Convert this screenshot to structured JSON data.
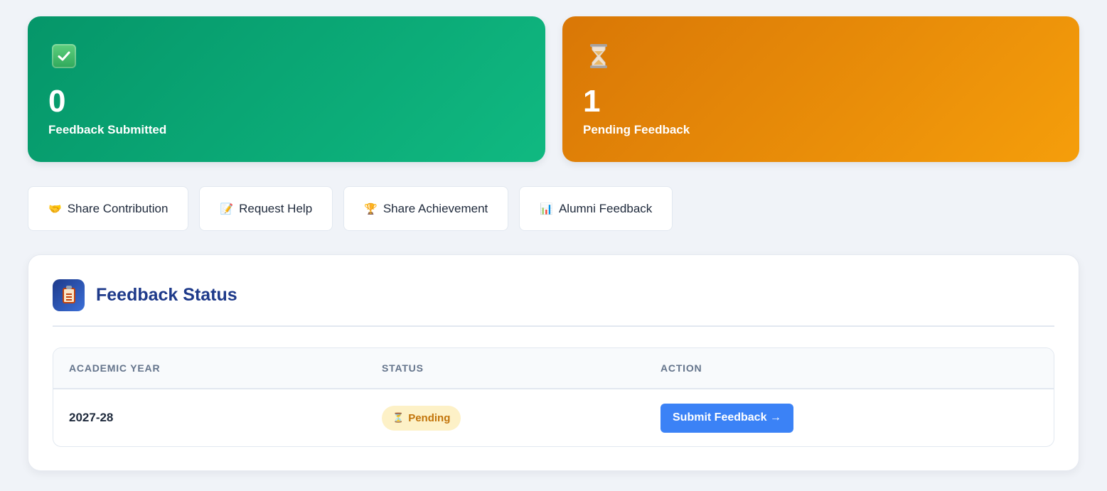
{
  "stats": [
    {
      "value": "0",
      "label": "Feedback Submitted",
      "icon": "check-mark-icon",
      "color": "#059669"
    },
    {
      "value": "1",
      "label": "Pending Feedback",
      "icon": "hourglass-icon",
      "emoji": "⏳",
      "color": "#d97706"
    }
  ],
  "actions": [
    {
      "emoji": "🤝",
      "label": "Share Contribution",
      "icon": "handshake-icon"
    },
    {
      "emoji": "📝",
      "label": "Request Help",
      "icon": "memo-icon"
    },
    {
      "emoji": "🏆",
      "label": "Share Achievement",
      "icon": "trophy-icon"
    },
    {
      "emoji": "📊",
      "label": "Alumni Feedback",
      "icon": "bar-chart-icon"
    }
  ],
  "panel": {
    "title": "Feedback Status",
    "icon": "clipboard-icon",
    "table": {
      "headers": [
        "ACADEMIC YEAR",
        "STATUS",
        "ACTION"
      ],
      "rows": [
        {
          "year": "2027-28",
          "status_emoji": "⏳",
          "status": "Pending",
          "action": "Submit Feedback →"
        }
      ]
    }
  },
  "colors": {
    "accent": "#3b82f6",
    "title": "#1e3a8a",
    "pending_bg": "#fdf1c7",
    "pending_text": "#c2740a"
  }
}
